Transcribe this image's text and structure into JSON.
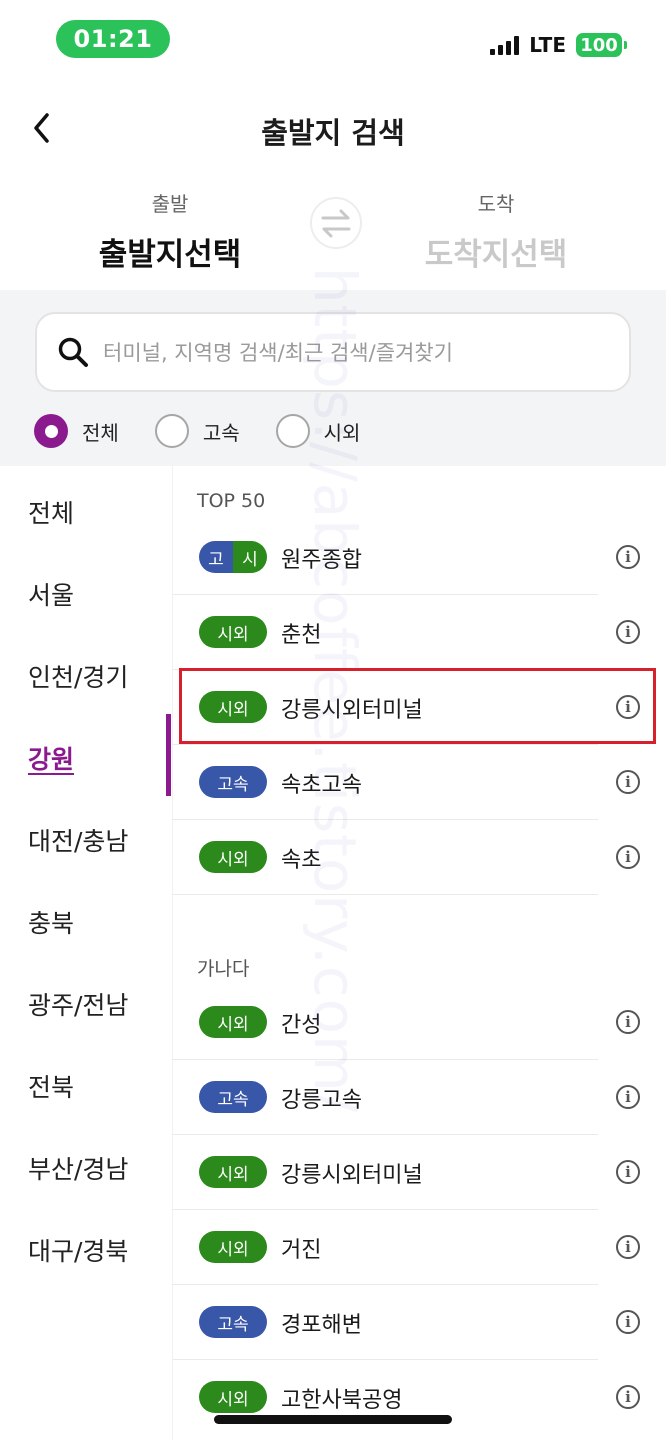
{
  "status": {
    "time": "01:21",
    "network": "LTE",
    "battery": "100"
  },
  "header": {
    "title": "출발지 검색",
    "back_icon": "chevron-left-icon"
  },
  "route": {
    "departure_label": "출발",
    "departure_value": "출발지선택",
    "arrival_label": "도착",
    "arrival_value": "도착지선택",
    "swap_icon": "swap-arrows-icon"
  },
  "search": {
    "placeholder": "터미널, 지역명 검색/최근 검색/즐겨찾기",
    "icon": "search-icon"
  },
  "filters": [
    {
      "label": "전체",
      "selected": true
    },
    {
      "label": "고속",
      "selected": false
    },
    {
      "label": "시외",
      "selected": false
    }
  ],
  "regions": [
    "전체",
    "서울",
    "인천/경기",
    "강원",
    "대전/충남",
    "충북",
    "광주/전남",
    "전북",
    "부산/경남",
    "대구/경북"
  ],
  "active_region": "강원",
  "sections": {
    "top": {
      "title": "TOP 50",
      "items": [
        {
          "badge": "고 시",
          "badge_left": "고",
          "badge_right": "시",
          "type": "both",
          "name": "원주종합"
        },
        {
          "badge": "시외",
          "type": "city",
          "name": "춘천"
        },
        {
          "badge": "시외",
          "type": "city",
          "name": "강릉시외터미널",
          "highlighted": true
        },
        {
          "badge": "고속",
          "type": "express",
          "name": "속초고속"
        },
        {
          "badge": "시외",
          "type": "city",
          "name": "속초"
        }
      ]
    },
    "alpha": {
      "title": "가나다",
      "items": [
        {
          "badge": "시외",
          "type": "city",
          "name": "간성"
        },
        {
          "badge": "고속",
          "type": "express",
          "name": "강릉고속"
        },
        {
          "badge": "시외",
          "type": "city",
          "name": "강릉시외터미널"
        },
        {
          "badge": "시외",
          "type": "city",
          "name": "거진"
        },
        {
          "badge": "고속",
          "type": "express",
          "name": "경포해변"
        },
        {
          "badge": "시외",
          "type": "city",
          "name": "고한사북공영"
        }
      ]
    }
  },
  "info_icon": "info-icon",
  "watermark": "https://abcoffee.tistory.com/",
  "colors": {
    "accent": "#8b1a8e",
    "city_badge": "#2b8a1b",
    "express_badge": "#3957a8",
    "highlight": "#d6202c",
    "status_green": "#2bc25a"
  }
}
